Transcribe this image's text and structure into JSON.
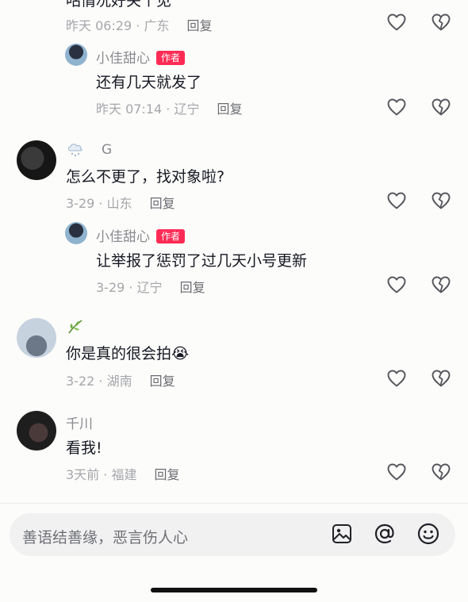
{
  "top_cut": {
    "text": "咕情况好关个见",
    "meta": "昨天 06:29 · 广东",
    "reply": "回复"
  },
  "comments": [
    {
      "id": "c_author1",
      "name": "小佳甜心",
      "badge": "作者",
      "text": "还有几天就发了",
      "meta": "昨天 07:14 · 辽宁",
      "reply": "回复"
    },
    {
      "id": "c_g",
      "name": "G",
      "badge_icon": "snow-cloud-icon",
      "text": "怎么不更了，找对象啦?",
      "meta": "3-29 · 山东",
      "reply": "回复"
    },
    {
      "id": "c_author2",
      "name": "小佳甜心",
      "badge": "作者",
      "text": "让举报了惩罚了过几天小号更新",
      "meta": "3-29 · 辽宁",
      "reply": "回复"
    },
    {
      "id": "c_leaf",
      "name_icon": "leaf-icon",
      "text": "你是真的很会拍😭",
      "meta": "3-22 · 湖南",
      "reply": "回复"
    },
    {
      "id": "c_qianchuan",
      "name": "千川",
      "text": "看我!",
      "meta": "3天前 · 福建",
      "reply": "回复"
    }
  ],
  "input": {
    "placeholder": "善语结善缘，恶言伤人心",
    "icons": [
      "image-icon",
      "at-icon",
      "emoji-icon"
    ]
  },
  "colors": {
    "background": "#fcfcfa",
    "author_badge": "#fe2c55",
    "meta_text": "#a5a6ab",
    "input_bg": "#f1f1f2"
  }
}
